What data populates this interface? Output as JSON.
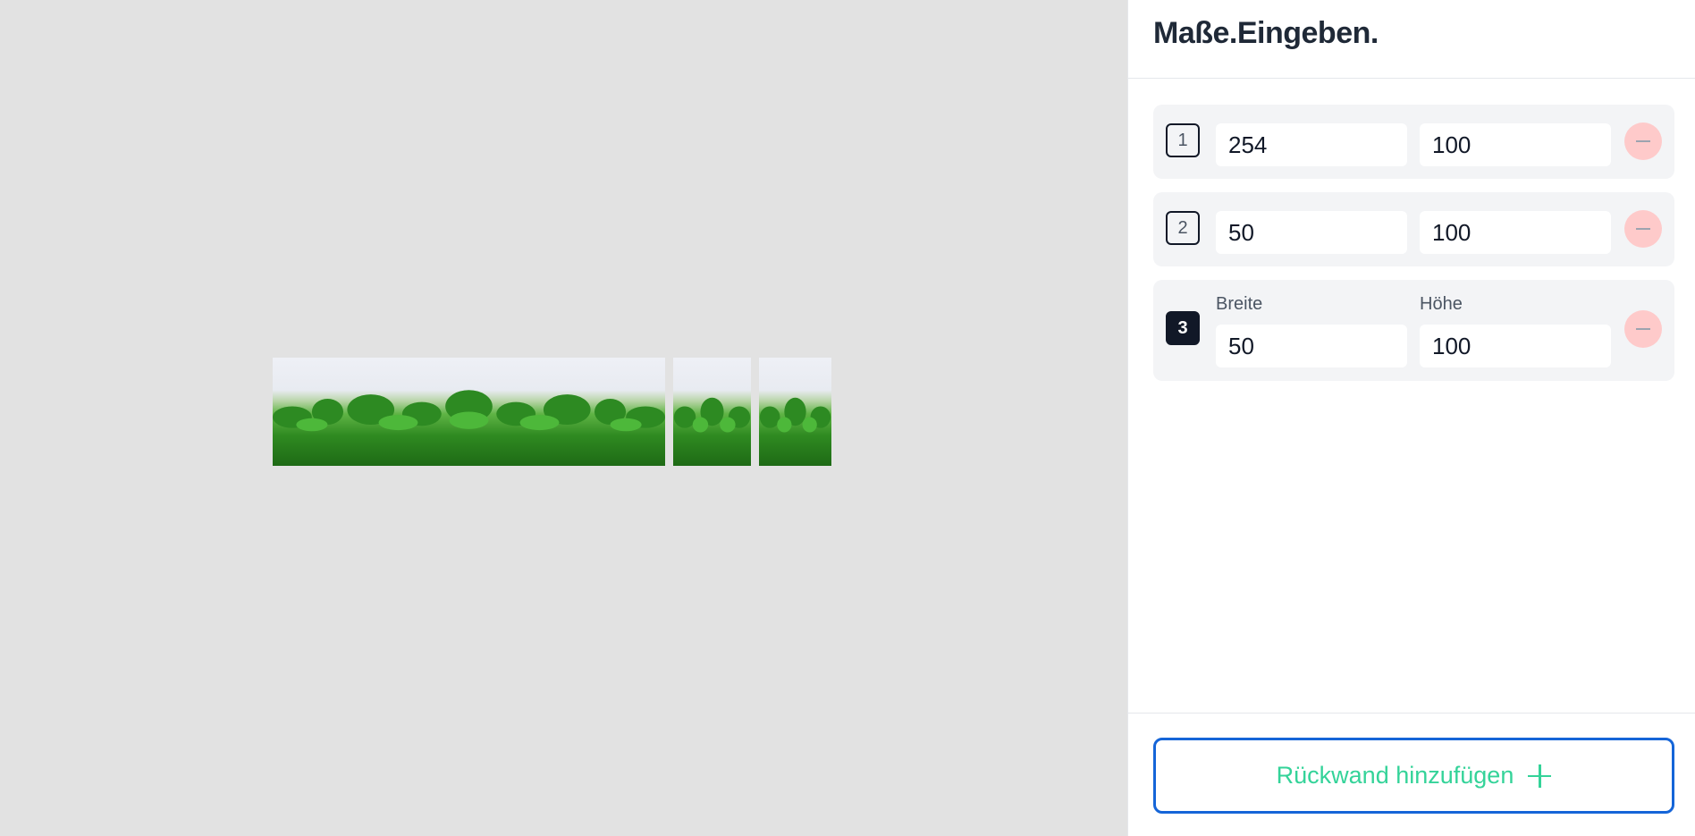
{
  "header": {
    "title": "Maße.Eingeben."
  },
  "rows": [
    {
      "number": "1",
      "width": "254",
      "height": "100"
    },
    {
      "number": "2",
      "width": "50",
      "height": "100"
    },
    {
      "number": "3",
      "width": "50",
      "height": "100",
      "width_label": "Breite",
      "height_label": "Höhe"
    }
  ],
  "footer": {
    "add_label": "Rückwand hinzufügen"
  },
  "icons": {
    "remove": "minus-icon",
    "add": "plus-icon"
  },
  "colors": {
    "accent_border": "#1565d8",
    "add_text": "#34d399",
    "remove_bg": "#fecaca"
  }
}
